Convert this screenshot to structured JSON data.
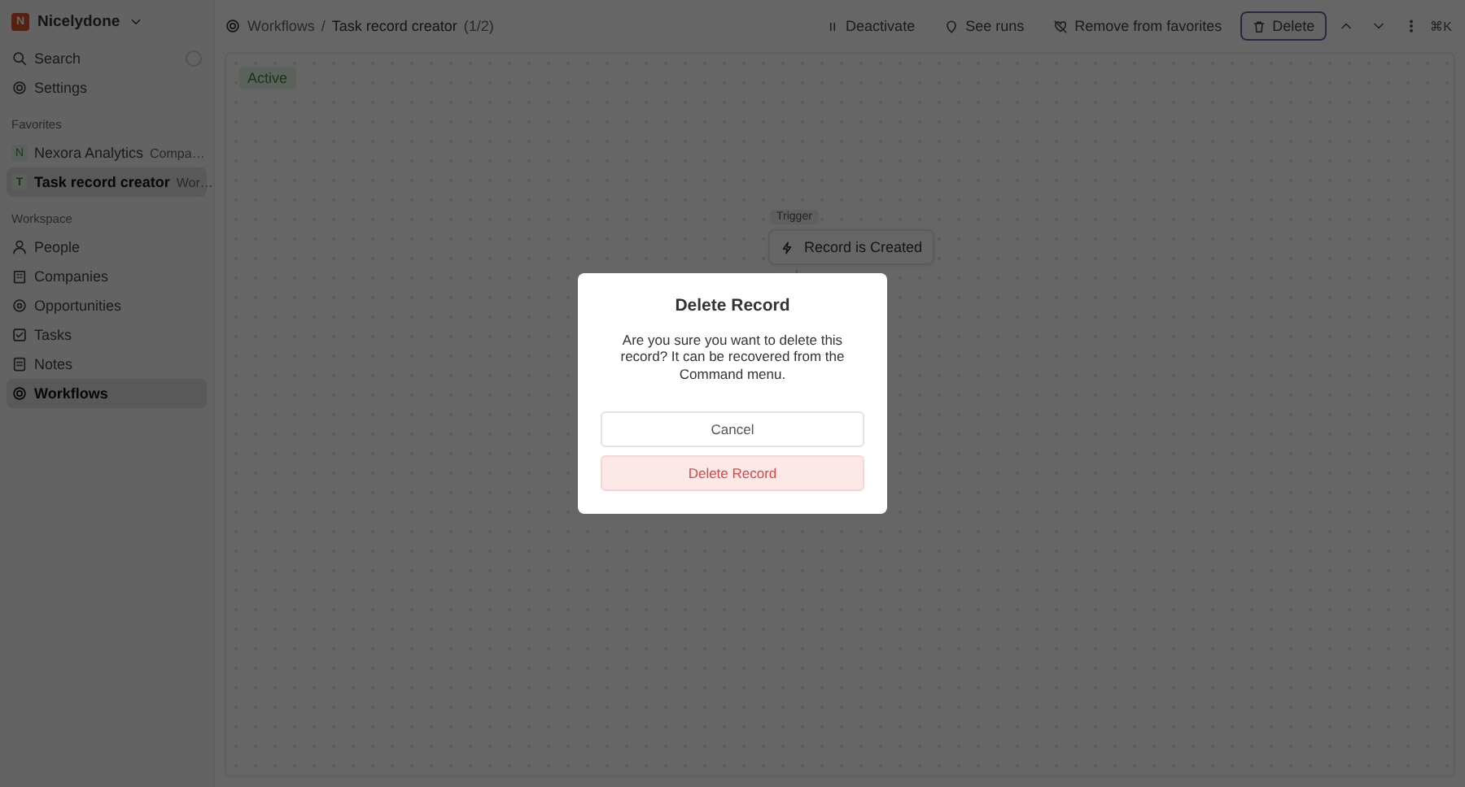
{
  "workspace": {
    "name": "Nicelydone",
    "initial": "N"
  },
  "sidebar": {
    "top_items": [
      {
        "label": "Search"
      },
      {
        "label": "Settings"
      }
    ],
    "favorites_heading": "Favorites",
    "favorites": [
      {
        "initial": "N",
        "label": "Nexora Analytics",
        "detail": "Compa…",
        "selected": false
      },
      {
        "initial": "T",
        "label": "Task record creator",
        "detail": "Wor…",
        "selected": true
      }
    ],
    "workspace_heading": "Workspace",
    "items": [
      {
        "label": "People",
        "selected": false
      },
      {
        "label": "Companies",
        "selected": false
      },
      {
        "label": "Opportunities",
        "selected": false
      },
      {
        "label": "Tasks",
        "selected": false
      },
      {
        "label": "Notes",
        "selected": false
      },
      {
        "label": "Workflows",
        "selected": true
      }
    ]
  },
  "breadcrumb": {
    "parent": "Workflows",
    "separator": "/",
    "current": "Task record creator",
    "count": "(1/2)"
  },
  "actions": [
    {
      "label": "Deactivate",
      "outlined": false
    },
    {
      "label": "See runs",
      "outlined": false
    },
    {
      "label": "Remove from favorites",
      "outlined": false
    },
    {
      "label": "Delete",
      "outlined": true
    }
  ],
  "shortcut": "⌘K",
  "status": "Active",
  "node": {
    "tag": "Trigger",
    "label": "Record is Created"
  },
  "dialog": {
    "title": "Delete Record",
    "message": "Are you sure you want to delete this record? It can be recovered from the Command menu.",
    "cancel": "Cancel",
    "confirm": "Delete Record"
  }
}
